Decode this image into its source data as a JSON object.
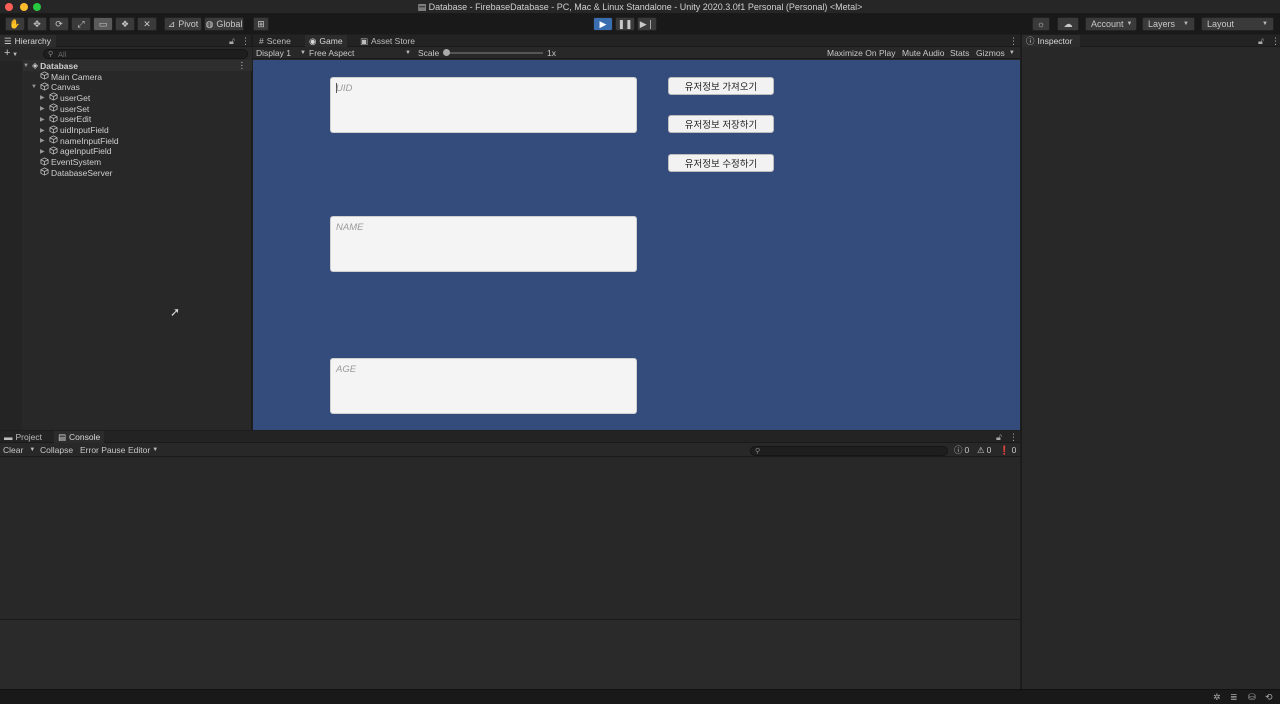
{
  "window": {
    "title": "Database - FirebaseDatabase - PC, Mac & Linux Standalone - Unity 2020.3.0f1 Personal (Personal) <Metal>"
  },
  "toolbar": {
    "tools": [
      {
        "name": "hand-tool",
        "icon": "hand-icon",
        "glyph": "✋"
      },
      {
        "name": "move-tool",
        "icon": "move-icon",
        "glyph": "✥"
      },
      {
        "name": "rotate-tool",
        "icon": "rotate-icon",
        "glyph": "⟳"
      },
      {
        "name": "scale-tool",
        "icon": "scale-icon",
        "glyph": "⤢"
      },
      {
        "name": "rect-tool",
        "icon": "rect-icon",
        "glyph": "▭"
      },
      {
        "name": "transform-tool",
        "icon": "transform-icon",
        "glyph": "❖"
      },
      {
        "name": "custom-tool",
        "icon": "wrench-icon",
        "glyph": "✕"
      }
    ],
    "pivot_label": "Pivot",
    "global_label": "Global",
    "account_label": "Account",
    "layers_label": "Layers",
    "layout_label": "Layout"
  },
  "hierarchy": {
    "tab_label": "Hierarchy",
    "add_label": "+",
    "search_placeholder": "All",
    "scene_name": "Database",
    "items": [
      {
        "label": "Main Camera",
        "depth": 1,
        "arrow": ""
      },
      {
        "label": "Canvas",
        "depth": 1,
        "arrow": "▼"
      },
      {
        "label": "userGet",
        "depth": 2,
        "arrow": "▶"
      },
      {
        "label": "userSet",
        "depth": 2,
        "arrow": "▶"
      },
      {
        "label": "userEdit",
        "depth": 2,
        "arrow": "▶"
      },
      {
        "label": "uidInputField",
        "depth": 2,
        "arrow": "▶"
      },
      {
        "label": "nameInputField",
        "depth": 2,
        "arrow": "▶"
      },
      {
        "label": "ageInputField",
        "depth": 2,
        "arrow": "▶"
      },
      {
        "label": "EventSystem",
        "depth": 1,
        "arrow": ""
      },
      {
        "label": "DatabaseServer",
        "depth": 1,
        "arrow": ""
      }
    ]
  },
  "center_tabs": {
    "scene": "Scene",
    "game": "Game",
    "asset_store": "Asset Store"
  },
  "game_toolbar": {
    "display": "Display 1",
    "aspect": "Free Aspect",
    "scale_label": "Scale",
    "scale_value": "1x",
    "maximize": "Maximize On Play",
    "mute": "Mute Audio",
    "stats": "Stats",
    "gizmos": "Gizmos"
  },
  "game": {
    "background": "#344c7c",
    "uid_placeholder": "UID",
    "name_placeholder": "NAME",
    "age_placeholder": "AGE",
    "buttons": {
      "get": "유저정보 가져오기",
      "save": "유저정보 저장하기",
      "edit": "유저정보 수정하기"
    }
  },
  "inspector": {
    "tab_label": "Inspector"
  },
  "bottom_tabs": {
    "project": "Project",
    "console": "Console"
  },
  "console": {
    "clear": "Clear",
    "collapse": "Collapse",
    "error_pause": "Error Pause",
    "editor": "Editor",
    "log_count": "0",
    "warn_count": "0",
    "error_count": "0"
  }
}
